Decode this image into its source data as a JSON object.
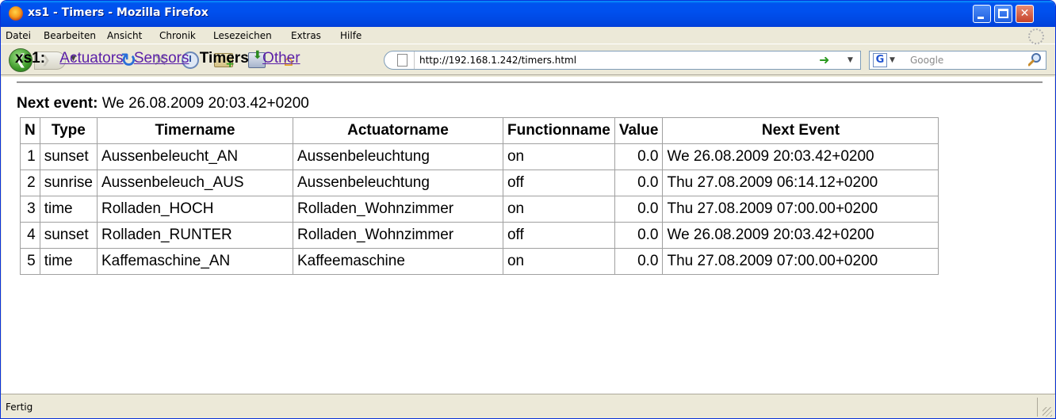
{
  "window": {
    "title": "xs1 - Timers - Mozilla Firefox"
  },
  "menu": [
    "Datei",
    "Bearbeiten",
    "Ansicht",
    "Chronik",
    "Lesezeichen",
    "Extras",
    "Hilfe"
  ],
  "toolbar": {
    "url": "http://192.168.1.242/timers.html",
    "search_placeholder": "Google"
  },
  "page": {
    "brand": "xs1:",
    "nav_links": [
      "Actuators",
      "Sensors"
    ],
    "nav_current": "Timers",
    "nav_other": "Other",
    "next_event_label": "Next event:",
    "next_event_value": "We 26.08.2009 20:03.42+0200"
  },
  "table": {
    "headers": [
      "N",
      "Type",
      "Timername",
      "Actuatorname",
      "Functionname",
      "Value",
      "Next Event"
    ],
    "rows": [
      [
        "1",
        "sunset",
        "Aussenbeleucht_AN",
        "Aussenbeleuchtung",
        "on",
        "0.0",
        "We 26.08.2009 20:03.42+0200"
      ],
      [
        "2",
        "sunrise",
        "Aussenbeleuch_AUS",
        "Aussenbeleuchtung",
        "off",
        "0.0",
        "Thu 27.08.2009 06:14.12+0200"
      ],
      [
        "3",
        "time",
        "Rolladen_HOCH",
        "Rolladen_Wohnzimmer",
        "on",
        "0.0",
        "Thu 27.08.2009 07:00.00+0200"
      ],
      [
        "4",
        "sunset",
        "Rolladen_RUNTER",
        "Rolladen_Wohnzimmer",
        "off",
        "0.0",
        "We 26.08.2009 20:03.42+0200"
      ],
      [
        "5",
        "time",
        "Kaffemaschine_AN",
        "Kaffeemaschine",
        "on",
        "0.0",
        "Thu 27.08.2009 07:00.00+0200"
      ]
    ]
  },
  "status": {
    "text": "Fertig"
  }
}
